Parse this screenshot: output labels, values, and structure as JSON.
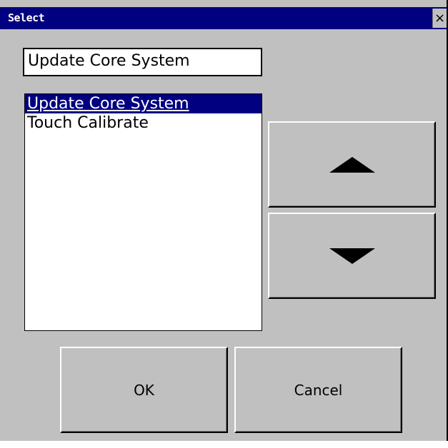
{
  "window": {
    "title": "Select",
    "close_label": "×",
    "background_color": "#c0c0c0",
    "titlebar_color": "#000080"
  },
  "selection_field": {
    "value": "Update Core System"
  },
  "list": {
    "items": [
      {
        "label": "Update Core System",
        "selected": true
      },
      {
        "label": "Touch Calibrate",
        "selected": false
      }
    ],
    "selected_color": "#000080"
  },
  "buttons": {
    "move_up_icon": "up-arrow-icon",
    "move_down_icon": "down-arrow-icon",
    "ok_label": "OK",
    "cancel_label": "Cancel"
  }
}
